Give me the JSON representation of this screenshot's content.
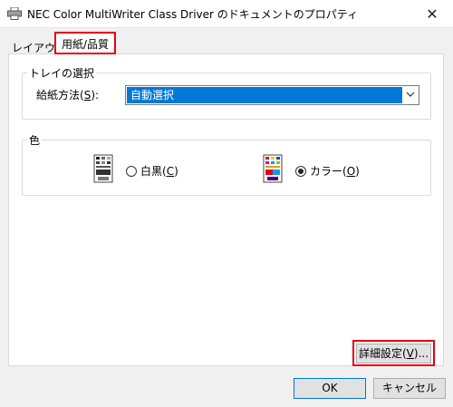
{
  "window": {
    "title": "NEC Color MultiWriter Class Driver のドキュメントのプロパティ",
    "close_glyph": "✕"
  },
  "tabs": [
    {
      "label": "レイアウト",
      "selected": false
    },
    {
      "label": "用紙/品質",
      "selected": true
    }
  ],
  "tray_group": {
    "title": "トレイの選択",
    "feed_label": "給紙方法(S):",
    "feed_value": "自動選択"
  },
  "color_group": {
    "title": "色",
    "options": [
      {
        "label": "白黒(C)",
        "checked": false,
        "icon": "bw-printer-icon"
      },
      {
        "label": "カラー(O)",
        "checked": true,
        "icon": "color-printer-icon"
      }
    ]
  },
  "buttons": {
    "advanced": "詳細設定(V)...",
    "ok": "OK",
    "cancel": "キャンセル"
  },
  "colors": {
    "highlight": "#e60012",
    "selection": "#0078d7"
  }
}
